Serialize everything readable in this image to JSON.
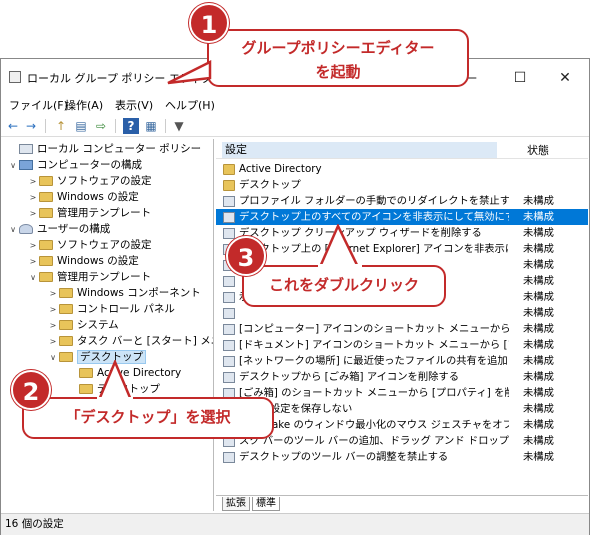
{
  "window": {
    "title": "ローカル グループ ポリシー エディター",
    "minimize": "—",
    "maximize": "☐",
    "close": "✕"
  },
  "menu": [
    "ファイル(F)",
    "操作(A)",
    "表示(V)",
    "ヘルプ(H)"
  ],
  "toolbar": {
    "back": "←",
    "forward": "→",
    "up": "↑",
    "props": "▤",
    "export": "⇨",
    "help": "?",
    "view": "▦",
    "filter": "▼"
  },
  "tree": [
    {
      "label": "ローカル コンピューター ポリシー",
      "expander": "",
      "icon": "policy-icon"
    },
    {
      "label": "コンピューターの構成",
      "expander": "∨",
      "icon": "computer-icon"
    },
    {
      "label": "ソフトウェアの設定",
      "expander": ">",
      "icon": "folder-icon"
    },
    {
      "label": "Windows の設定",
      "expander": ">",
      "icon": "folder-icon"
    },
    {
      "label": "管理用テンプレート",
      "expander": ">",
      "icon": "folder-icon"
    },
    {
      "label": "ユーザーの構成",
      "expander": "∨",
      "icon": "user-icon"
    },
    {
      "label": "ソフトウェアの設定",
      "expander": ">",
      "icon": "folder-icon"
    },
    {
      "label": "Windows の設定",
      "expander": ">",
      "icon": "folder-icon"
    },
    {
      "label": "管理用テンプレート",
      "expander": "∨",
      "icon": "folder-icon"
    },
    {
      "label": "Windows コンポーネント",
      "expander": ">",
      "icon": "folder-icon"
    },
    {
      "label": "コントロール パネル",
      "expander": ">",
      "icon": "folder-icon"
    },
    {
      "label": "システム",
      "expander": ">",
      "icon": "folder-icon"
    },
    {
      "label": "タスク バーと [スタート] メニュー",
      "expander": ">",
      "icon": "folder-icon"
    },
    {
      "label": "デスクトップ",
      "expander": "∨",
      "icon": "folder-icon"
    },
    {
      "label": "Active Directory",
      "expander": "",
      "icon": "folder-icon"
    },
    {
      "label": "デスクトップ",
      "expander": "",
      "icon": "folder-icon"
    }
  ],
  "list": {
    "header": {
      "setting": "設定",
      "state": "状態"
    },
    "rows": [
      {
        "text": "Active Directory",
        "state": "",
        "icon": "folder-icon"
      },
      {
        "text": "デスクトップ",
        "state": "",
        "icon": "folder-icon"
      },
      {
        "text": "プロファイル フォルダーの手動でのリダイレクトを禁止する",
        "state": "未構成",
        "icon": "policy-icon"
      },
      {
        "text": "デスクトップ上のすべてのアイコンを非表示にして無効にする",
        "state": "未構成",
        "icon": "policy-icon"
      },
      {
        "text": "デスクトップ クリーンアップ ウィザードを削除する",
        "state": "未構成",
        "icon": "policy-icon"
      },
      {
        "text": "デスクトップ上の [Internet Explorer] アイコンを非表示にする",
        "state": "未構成",
        "icon": "policy-icon"
      },
      {
        "text": "",
        "state": "未構成",
        "icon": "policy-icon"
      },
      {
        "text": "",
        "state": "未構成",
        "icon": "policy-icon"
      },
      {
        "text": "示にする",
        "state": "未構成",
        "icon": "policy-icon"
      },
      {
        "text": "",
        "state": "未構成",
        "icon": "policy-icon"
      },
      {
        "text": "[コンピューター] アイコンのショートカット メニューから [プロパティ...",
        "state": "未構成",
        "icon": "policy-icon"
      },
      {
        "text": "[ドキュメント] アイコンのショートカット メニューから [プロパティ]...",
        "state": "未構成",
        "icon": "policy-icon"
      },
      {
        "text": "[ネットワークの場所] に最近使ったファイルの共有を追加しない",
        "state": "未構成",
        "icon": "policy-icon"
      },
      {
        "text": "デスクトップから [ごみ箱] アイコンを削除する",
        "state": "未構成",
        "icon": "policy-icon"
      },
      {
        "text": "[ごみ箱] のショートカット メニューから [プロパティ] を削除する",
        "state": "未構成",
        "icon": "policy-icon"
      },
      {
        "text": "了時に設定を保存しない",
        "state": "未構成",
        "icon": "policy-icon"
      },
      {
        "text": "ero Shake のウィンドウ最小化のマウス ジェスチャをオフにする",
        "state": "未構成",
        "icon": "policy-icon"
      },
      {
        "text": "スク バーのツール バーの追加、ドラッグ アンド ドロップおよび...",
        "state": "未構成",
        "icon": "policy-icon"
      },
      {
        "text": "デスクトップのツール バーの調整を禁止する",
        "state": "未構成",
        "icon": "policy-icon"
      }
    ]
  },
  "tabs": [
    "拡張",
    "標準"
  ],
  "status": "16 個の設定",
  "callouts": {
    "c1_num": "1",
    "c1_line1": "グループポリシーエディター",
    "c1_line2": "を起動",
    "c2_num": "2",
    "c2_text": "「デスクトップ」を選択",
    "c3_num": "3",
    "c3_text": "これをダブルクリック"
  },
  "colors": {
    "accent": "#c32a2a",
    "selection": "#0078d7"
  }
}
